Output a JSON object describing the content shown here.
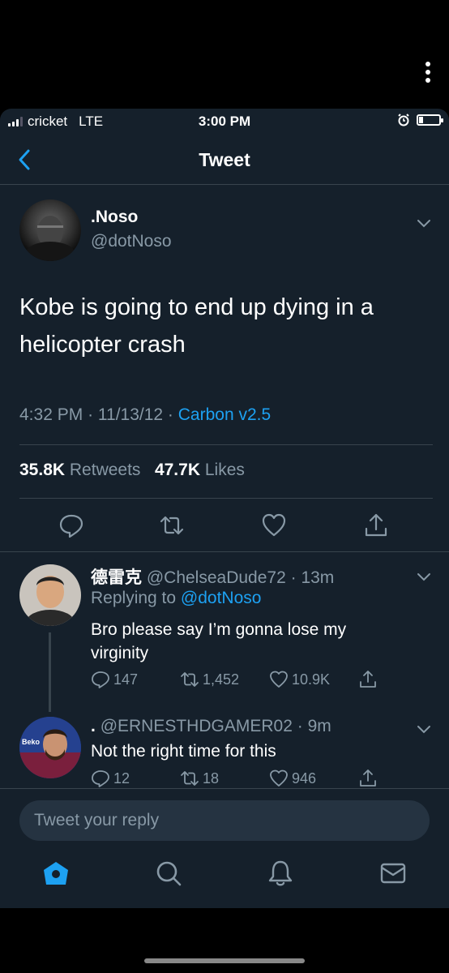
{
  "status_bar": {
    "carrier": "cricket",
    "network": "LTE",
    "time": "3:00 PM"
  },
  "nav": {
    "title": "Tweet"
  },
  "tweet": {
    "display_name": ".Noso",
    "handle": "@dotNoso",
    "text": "Kobe is going to end up dying in a helicopter crash",
    "time": "4:32 PM",
    "date": "11/13/12",
    "source": "Carbon v2.5",
    "retweet_count": "35.8K",
    "retweet_label": "Retweets",
    "like_count": "47.7K",
    "like_label": "Likes"
  },
  "replies": [
    {
      "name": "德雷克",
      "handle": "@ChelseaDude72",
      "time": "13m",
      "replying_label": "Replying to",
      "replying_to": "@dotNoso",
      "text": "Bro please say I’m gonna lose my virginity",
      "reply_count": "147",
      "retweet_count": "1,452",
      "like_count": "10.9K"
    },
    {
      "name": ".",
      "handle": "@ERNESTHDGAMER02",
      "time": "9m",
      "text": "Not the right time for this",
      "reply_count": "12",
      "retweet_count": "18",
      "like_count": "946"
    }
  ],
  "composer": {
    "placeholder": "Tweet your reply"
  },
  "colors": {
    "background": "#15202b",
    "accent": "#1da1f2",
    "secondary_text": "#8899a6",
    "divider": "#38444d"
  }
}
